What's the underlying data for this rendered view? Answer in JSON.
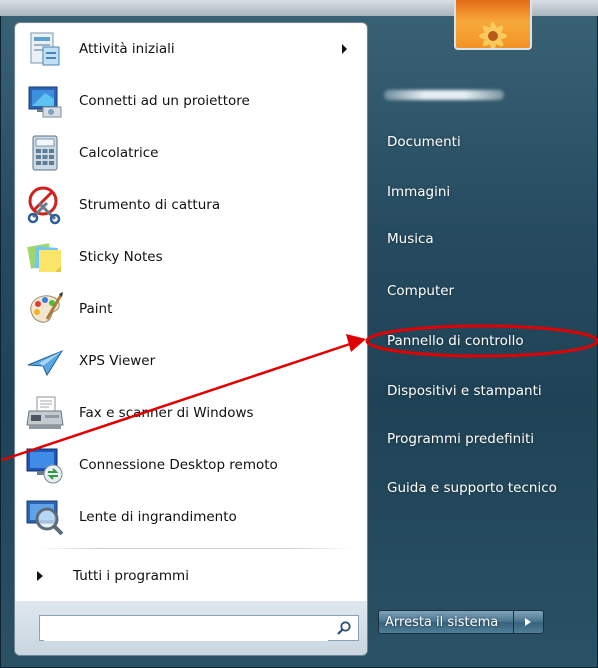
{
  "start_menu": {
    "programs": [
      {
        "label": "Attività iniziali",
        "icon": "getting-started-icon",
        "has_submenu": true
      },
      {
        "label": "Connetti ad un proiettore",
        "icon": "projector-icon"
      },
      {
        "label": "Calcolatrice",
        "icon": "calculator-icon"
      },
      {
        "label": "Strumento di cattura",
        "icon": "snipping-tool-icon"
      },
      {
        "label": "Sticky Notes",
        "icon": "sticky-notes-icon"
      },
      {
        "label": "Paint",
        "icon": "paint-palette-icon"
      },
      {
        "label": "XPS Viewer",
        "icon": "xps-viewer-icon"
      },
      {
        "label": "Fax e scanner di Windows",
        "icon": "fax-scanner-icon"
      },
      {
        "label": "Connessione Desktop remoto",
        "icon": "remote-desktop-icon"
      },
      {
        "label": "Lente di ingrandimento",
        "icon": "magnifier-icon"
      }
    ],
    "all_programs": "Tutti i programmi",
    "search": {
      "placeholder": "",
      "value": ""
    },
    "right_items": [
      "Documenti",
      "Immagini",
      "Musica",
      "Computer",
      "Pannello di controllo",
      "Dispositivi e stampanti",
      "Programmi predefiniti",
      "Guida e supporto tecnico"
    ],
    "shutdown_label": "Arresta il sistema"
  },
  "annotation": {
    "highlight_color": "#e00000",
    "target": "Pannello di controllo"
  }
}
